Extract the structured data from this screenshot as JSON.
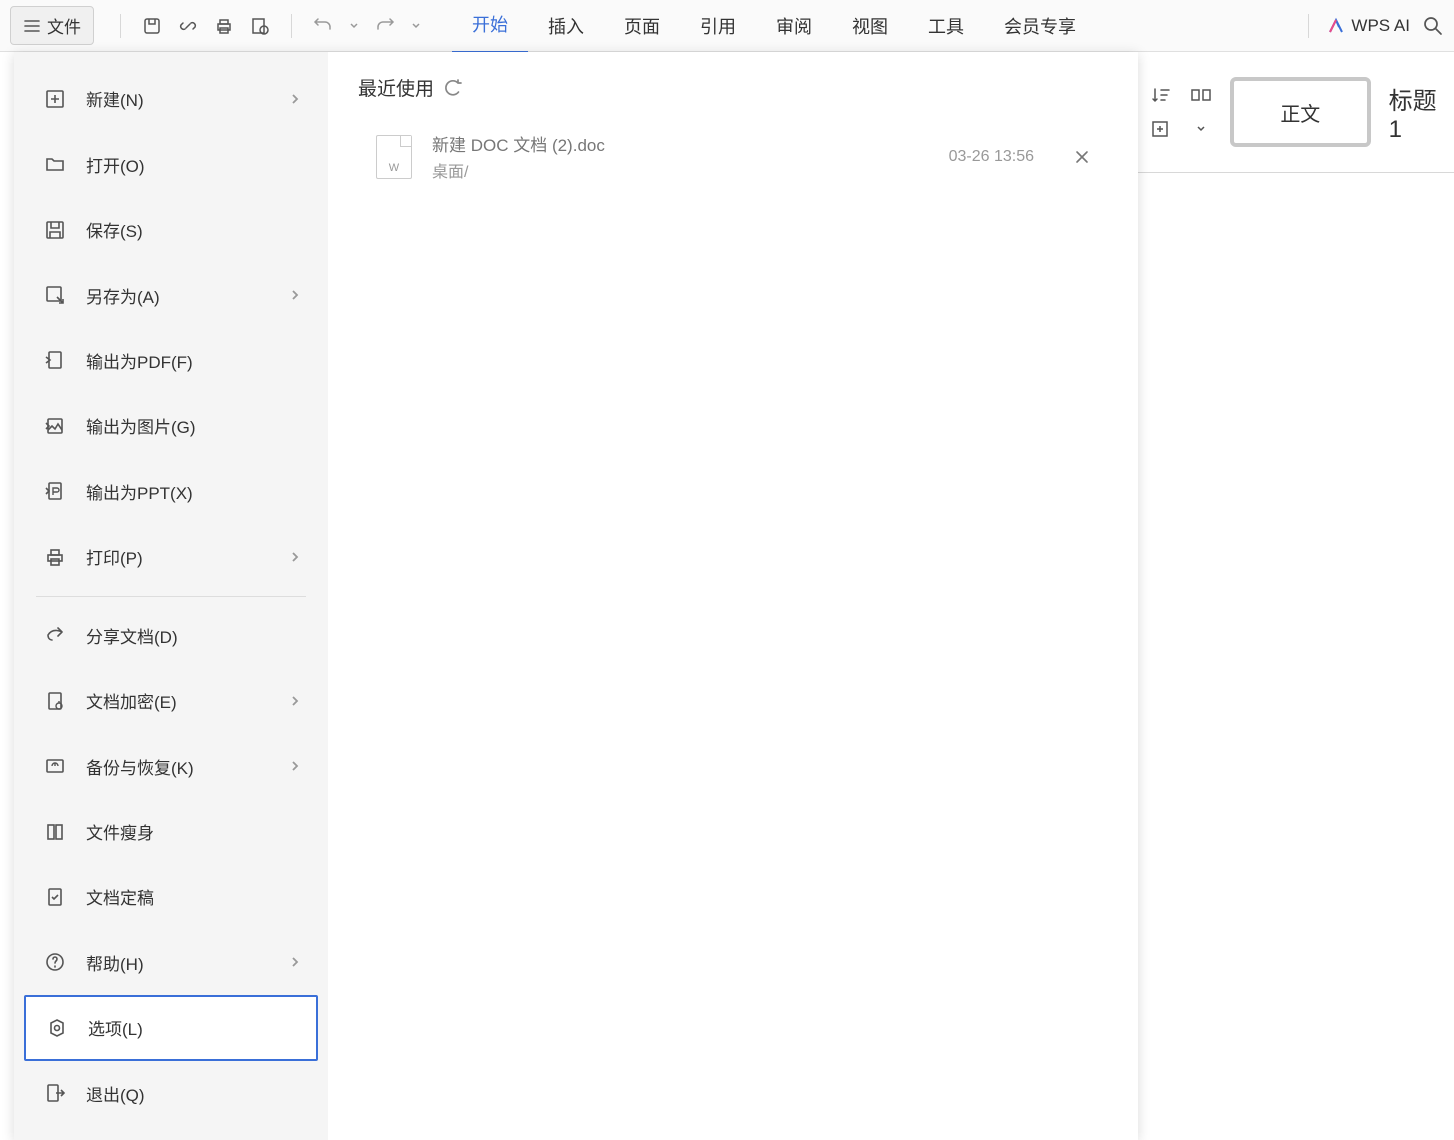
{
  "toolbar": {
    "file_label": "文件",
    "wps_ai_label": "WPS AI"
  },
  "tabs": [
    {
      "label": "开始",
      "active": true
    },
    {
      "label": "插入",
      "active": false
    },
    {
      "label": "页面",
      "active": false
    },
    {
      "label": "引用",
      "active": false
    },
    {
      "label": "审阅",
      "active": false
    },
    {
      "label": "视图",
      "active": false
    },
    {
      "label": "工具",
      "active": false
    },
    {
      "label": "会员专享",
      "active": false
    }
  ],
  "file_menu": {
    "items": [
      {
        "key": "new",
        "label": "新建(N)",
        "has_submenu": true
      },
      {
        "key": "open",
        "label": "打开(O)",
        "has_submenu": false
      },
      {
        "key": "save",
        "label": "保存(S)",
        "has_submenu": false
      },
      {
        "key": "saveas",
        "label": "另存为(A)",
        "has_submenu": true
      },
      {
        "key": "exportpdf",
        "label": "输出为PDF(F)",
        "has_submenu": false
      },
      {
        "key": "exportimg",
        "label": "输出为图片(G)",
        "has_submenu": false
      },
      {
        "key": "exportppt",
        "label": "输出为PPT(X)",
        "has_submenu": false
      },
      {
        "key": "print",
        "label": "打印(P)",
        "has_submenu": true
      },
      {
        "key": "divider1",
        "divider": true
      },
      {
        "key": "share",
        "label": "分享文档(D)",
        "has_submenu": false
      },
      {
        "key": "encrypt",
        "label": "文档加密(E)",
        "has_submenu": true
      },
      {
        "key": "backup",
        "label": "备份与恢复(K)",
        "has_submenu": true
      },
      {
        "key": "slim",
        "label": "文件瘦身",
        "has_submenu": false
      },
      {
        "key": "finalize",
        "label": "文档定稿",
        "has_submenu": false
      },
      {
        "key": "help",
        "label": "帮助(H)",
        "has_submenu": true
      },
      {
        "key": "options",
        "label": "选项(L)",
        "has_submenu": false,
        "selected": true
      },
      {
        "key": "exit",
        "label": "退出(Q)",
        "has_submenu": false
      }
    ],
    "recent_header": "最近使用",
    "recent_files": [
      {
        "name": "新建 DOC 文档 (2).doc",
        "path": "桌面/",
        "time": "03-26 13:56",
        "ext": "W"
      }
    ]
  },
  "ribbon_extra": {
    "style_body": "正文",
    "style_heading": "标题 1"
  }
}
